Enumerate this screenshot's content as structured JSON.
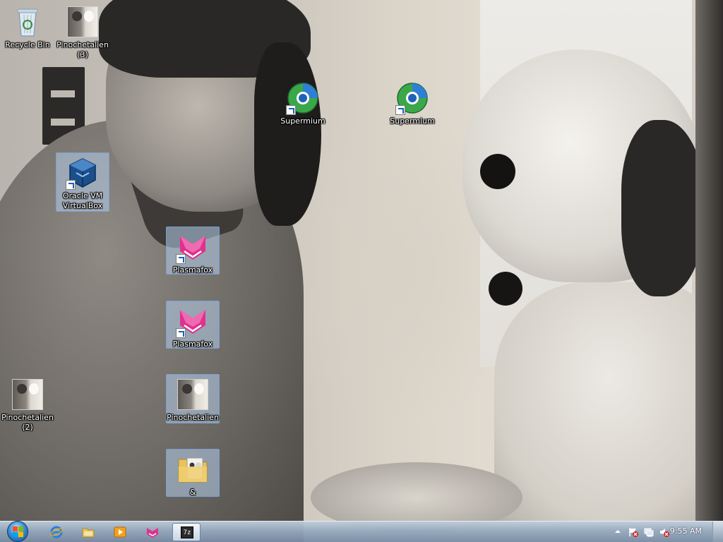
{
  "desktop": {
    "icons": [
      {
        "id": "recycle-bin",
        "label": "Recycle Bin",
        "icon": "recycle-bin-icon",
        "shortcut": false,
        "selected": false
      },
      {
        "id": "pinochetalien-3",
        "label": "Pinochetalien\n(3)",
        "icon": "photo-thumbnail-icon",
        "shortcut": false,
        "selected": false
      },
      {
        "id": "supermium-1",
        "label": "Supermium",
        "icon": "supermium-browser-icon",
        "shortcut": true,
        "selected": false
      },
      {
        "id": "supermium-2",
        "label": "Supermium",
        "icon": "supermium-browser-icon",
        "shortcut": true,
        "selected": false
      },
      {
        "id": "virtualbox",
        "label": "Oracle VM\nVirtualBox",
        "icon": "virtualbox-icon",
        "shortcut": true,
        "selected": true
      },
      {
        "id": "plasmafox-1",
        "label": "Plasmafox",
        "icon": "plasmafox-icon",
        "shortcut": true,
        "selected": true
      },
      {
        "id": "plasmafox-2",
        "label": "Plasmafox",
        "icon": "plasmafox-icon",
        "shortcut": true,
        "selected": true
      },
      {
        "id": "pinochetalien-2",
        "label": "Pinochetalien\n(2)",
        "icon": "photo-thumbnail-icon",
        "shortcut": false,
        "selected": false
      },
      {
        "id": "pinochetalien",
        "label": "Pinochetalien",
        "icon": "photo-thumbnail-icon",
        "shortcut": false,
        "selected": true
      },
      {
        "id": "ampersand-folder",
        "label": "&",
        "icon": "folder-icon",
        "shortcut": false,
        "selected": true
      }
    ]
  },
  "taskbar": {
    "start": {
      "icon": "windows-start-orb-icon"
    },
    "pinned": [
      {
        "id": "ie",
        "icon": "internet-explorer-icon",
        "active": false
      },
      {
        "id": "explorer",
        "icon": "file-explorer-icon",
        "active": false
      },
      {
        "id": "media-player",
        "icon": "media-player-icon",
        "active": false
      },
      {
        "id": "plasmafox",
        "icon": "plasmafox-icon",
        "active": false
      },
      {
        "id": "sevenzip",
        "icon": "7zip-icon",
        "label": "7z",
        "active": true
      }
    ],
    "tray": {
      "icons": [
        "show-hidden-icons-chevron-icon",
        "action-center-icon",
        "network-icon",
        "volume-muted-icon"
      ],
      "clock": "9:55 AM"
    }
  },
  "colors": {
    "selection_bg": "#b4cdeb",
    "taskbar_top": "#becddc",
    "taskbar_bottom": "#788ca5",
    "plasmafox_pink": "#e0318f",
    "virtualbox_blue": "#1b4f8c",
    "supermium_green": "#3aa84a"
  }
}
